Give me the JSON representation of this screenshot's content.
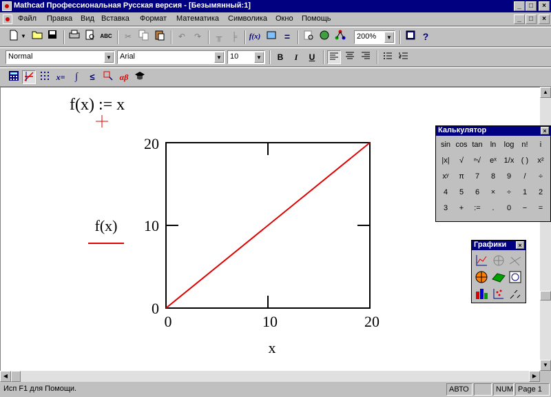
{
  "window": {
    "title": "Mathcad Профессиональная Русская версия - [Безымянный:1]",
    "controls": [
      "_",
      "□",
      "×"
    ]
  },
  "menu": [
    "Файл",
    "Правка",
    "Вид",
    "Вставка",
    "Формат",
    "Математика",
    "Символика",
    "Окно",
    "Помощь"
  ],
  "toolbar": {
    "zoom": "200%",
    "style": "Normal",
    "font": "Arial",
    "font_size": "10",
    "bold": "B",
    "italic": "I",
    "underline": "U",
    "math_icons": [
      "x=",
      "αβ"
    ]
  },
  "worksheet": {
    "definition": "f(x) := x",
    "plot_y_label": "f(x)",
    "plot_x_label": "x",
    "y_ticks": [
      "20",
      "10",
      "0"
    ],
    "x_ticks": [
      "0",
      "10",
      "20"
    ]
  },
  "chart_data": {
    "type": "line",
    "series": [
      {
        "name": "f(x)",
        "x": [
          0,
          20
        ],
        "y": [
          0,
          20
        ],
        "color": "#e00000"
      }
    ],
    "xlim": [
      0,
      20
    ],
    "ylim": [
      0,
      20
    ],
    "xlabel": "x",
    "ylabel": "f(x)"
  },
  "calculator": {
    "title": "Калькулятор",
    "rows": [
      [
        "sin",
        "cos",
        "tan",
        "ln",
        "log",
        "n!",
        "i"
      ],
      [
        "|x|",
        "√",
        "ⁿ√",
        "eˣ",
        "1/x",
        "( )",
        "x²"
      ],
      [
        "xʸ",
        "π",
        "7",
        "8",
        "9",
        "/",
        "÷"
      ],
      [
        "4",
        "5",
        "6",
        "×",
        "÷",
        "1",
        "2"
      ],
      [
        "3",
        "+",
        ":=",
        ".",
        "0",
        "−",
        "="
      ]
    ]
  },
  "graphs": {
    "title": "Графики"
  },
  "status": {
    "hint": "Исп F1 для Помощи.",
    "auto": "АВТО",
    "num": "NUM",
    "page": "Page 1"
  }
}
